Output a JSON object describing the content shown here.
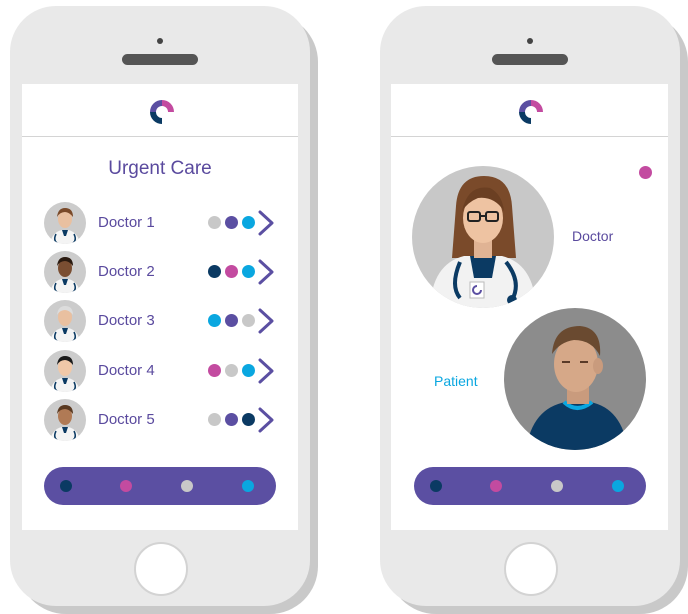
{
  "colors": {
    "purple": "#5b4fa2",
    "text_purple": "#5a4a9e",
    "magenta": "#c34ba0",
    "cyan": "#0aa7e0",
    "navy": "#0b3a63",
    "gray": "#c8c8c8"
  },
  "left_phone": {
    "title": "Urgent Care",
    "doctors": [
      {
        "label": "Doctor 1",
        "dots": [
          "#c8c8c8",
          "#5b4fa2",
          "#0aa7e0"
        ]
      },
      {
        "label": "Doctor 2",
        "dots": [
          "#0b3a63",
          "#c34ba0",
          "#0aa7e0"
        ]
      },
      {
        "label": "Doctor 3",
        "dots": [
          "#0aa7e0",
          "#5b4fa2",
          "#c8c8c8"
        ]
      },
      {
        "label": "Doctor 4",
        "dots": [
          "#c34ba0",
          "#c8c8c8",
          "#0aa7e0"
        ]
      },
      {
        "label": "Doctor 5",
        "dots": [
          "#c8c8c8",
          "#5b4fa2",
          "#0b3a63"
        ]
      }
    ],
    "nav_dots": [
      "#0b3a63",
      "#c34ba0",
      "#c8c8c8",
      "#0aa7e0"
    ]
  },
  "right_phone": {
    "doctor_label": "Doctor",
    "patient_label": "Patient",
    "status_dot": "#c34ba0",
    "nav_dots": [
      "#0b3a63",
      "#c34ba0",
      "#c8c8c8",
      "#0aa7e0"
    ]
  },
  "icons": {
    "logo": "app-logo-icon",
    "chevron": "chevron-right-icon",
    "home": "home-button"
  }
}
